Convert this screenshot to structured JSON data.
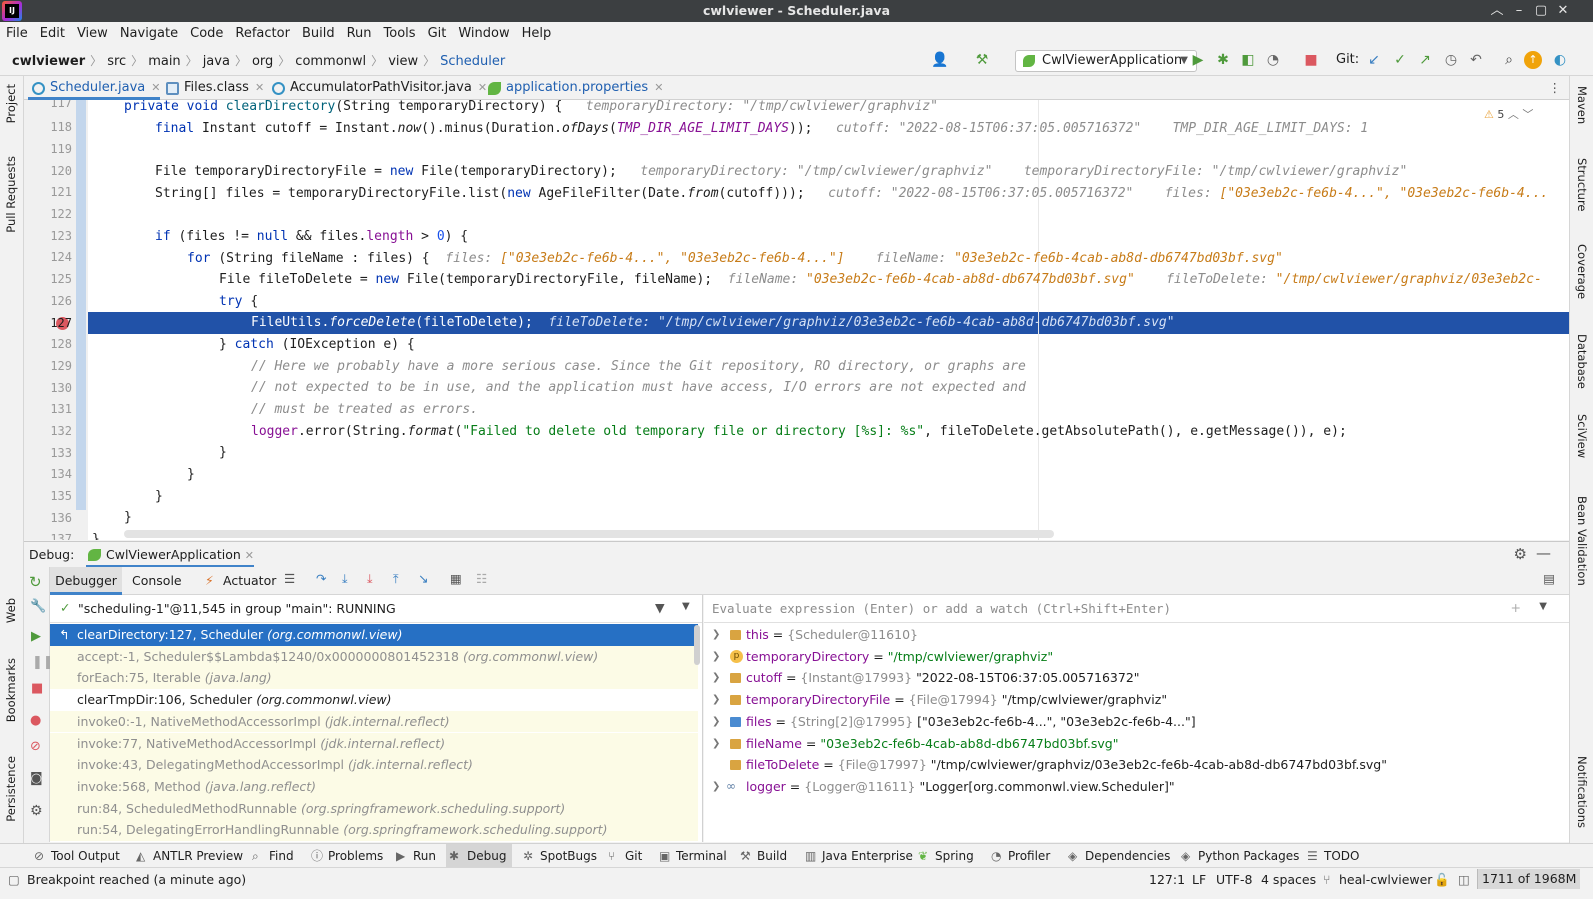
{
  "window": {
    "title": "cwlviewer - Scheduler.java",
    "logo_text": "IJ",
    "controls": [
      "︿",
      "–",
      "▢",
      "✕"
    ]
  },
  "menu": [
    "File",
    "Edit",
    "View",
    "Navigate",
    "Code",
    "Refactor",
    "Build",
    "Run",
    "Tools",
    "Git",
    "Window",
    "Help"
  ],
  "breadcrumb": [
    "cwlviewer",
    "src",
    "main",
    "java",
    "org",
    "commonwl",
    "view",
    "Scheduler"
  ],
  "toolbar": {
    "run_config": "CwlViewerApplication",
    "git_label": "Git:"
  },
  "tabs": [
    {
      "label": "Scheduler.java",
      "active": true
    },
    {
      "label": "Files.class",
      "active": false
    },
    {
      "label": "AccumulatorPathVisitor.java",
      "active": false
    },
    {
      "label": "application.properties",
      "active": false
    }
  ],
  "left_tools": [
    "Project",
    "Pull Requests",
    "Web",
    "Bookmarks",
    "Persistence"
  ],
  "right_tools": [
    "Maven",
    "Structure",
    "Coverage",
    "Database",
    "SciView",
    "Bean Validation",
    "Notifications"
  ],
  "editor": {
    "problems_count": "5",
    "line_numbers": [
      "117",
      "118",
      "119",
      "120",
      "121",
      "122",
      "123",
      "124",
      "125",
      "126",
      "127",
      "128",
      "129",
      "130",
      "131",
      "132",
      "133",
      "134",
      "135",
      "136",
      "137"
    ],
    "current_line": "127",
    "lines": {
      "l117_kw": "private void ",
      "l117_fn": "clearDirectory",
      "l117_rest": "(String temporaryDirectory) {",
      "l117_hint": "temporaryDirectory: ",
      "l117_hv": "\"/tmp/cwlviewer/graphviz\"",
      "l118_kw": "final ",
      "l118_a": "Instant cutoff = Instant.",
      "l118_now": "now",
      "l118_b": "().minus(Duration.",
      "l118_ofdays": "ofDays",
      "l118_c": "(",
      "l118_const": "TMP_DIR_AGE_LIMIT_DAYS",
      "l118_d": "));",
      "l118_hint1": "cutoff: ",
      "l118_hv1": "\"2022-08-15T06:37:05.005716372\"",
      "l118_hint2": "TMP_DIR_AGE_LIMIT_DAYS: ",
      "l118_hv2": "1",
      "l120_a": "File temporaryDirectoryFile = ",
      "l120_kw": "new ",
      "l120_b": "File(temporaryDirectory);",
      "l120_hint1": "temporaryDirectory: ",
      "l120_hv1": "\"/tmp/cwlviewer/graphviz\"",
      "l120_hint2": "temporaryDirectoryFile: ",
      "l120_hv2": "\"/tmp/cwlviewer/graphviz\"",
      "l121_a": "String[] files = temporaryDirectoryFile.list(",
      "l121_kw": "new ",
      "l121_b": "AgeFileFilter(Date.",
      "l121_from": "from",
      "l121_c": "(cutoff)));",
      "l121_hint1": "cutoff: ",
      "l121_hv1": "\"2022-08-15T06:37:05.005716372\"",
      "l121_hint2": "files: ",
      "l121_hv2": "[\"03e3eb2c-fe6b-4...\", \"03e3eb2c-fe6b-4...",
      "l123_kw": "if ",
      "l123_a": "(files != ",
      "l123_null": "null",
      "l123_b": " && files.",
      "l123_len": "length",
      "l123_c": " > ",
      "l123_num": "0",
      "l123_d": ") {",
      "l124_kw": "for ",
      "l124_a": "(String fileName : files) {",
      "l124_hint1": "files: ",
      "l124_hv1": "[\"03e3eb2c-fe6b-4...\", \"03e3eb2c-fe6b-4...\"]",
      "l124_hint2": "fileName: ",
      "l124_hv2": "\"03e3eb2c-fe6b-4cab-ab8d-db6747bd03bf.svg\"",
      "l125_a": "File fileToDelete = ",
      "l125_kw": "new ",
      "l125_b": "File(temporaryDirectoryFile, fileName);",
      "l125_hint1": "fileName: ",
      "l125_hv1": "\"03e3eb2c-fe6b-4cab-ab8d-db6747bd03bf.svg\"",
      "l125_hint2": "fileToDelete: ",
      "l125_hv2": "\"/tmp/cwlviewer/graphviz/03e3eb2c-",
      "l126_kw": "try ",
      "l126_a": "{",
      "l127_a": "FileUtils.",
      "l127_fn": "forceDelete",
      "l127_b": "(fileToDelete);",
      "l127_hint": "fileToDelete: ",
      "l127_hv": "\"/tmp/cwlviewer/graphviz/03e3eb2c-fe6b-4cab-ab8d-db6747bd03bf.svg\"",
      "l128_a": "} ",
      "l128_kw": "catch ",
      "l128_b": "(IOException e) {",
      "l129": "// Here we probably have a more serious case. Since the Git repository, RO directory, or graphs are",
      "l130": "// not expected to be in use, and the application must have access, I/O errors are not expected and",
      "l131": "// must be treated as errors.",
      "l132_logger": "logger",
      "l132_a": ".error(String.",
      "l132_format": "format",
      "l132_b": "(",
      "l132_str": "\"Failed to delete old temporary file or directory [%s]: %s\"",
      "l132_c": ", fileToDelete.getAbsolutePath(), e.getMessage()), e);",
      "l133": "}",
      "l134": "}",
      "l135": "}",
      "l136": "}",
      "l137": "}"
    }
  },
  "debug": {
    "label": "Debug:",
    "session_tab": "CwlViewerApplication",
    "tabs": [
      "Debugger",
      "Console",
      "Actuator"
    ],
    "thread": "\"scheduling-1\"@11,545 in group \"main\": RUNNING",
    "eval_placeholder": "Evaluate expression (Enter) or add a watch (Ctrl+Shift+Enter)",
    "frames": [
      {
        "method": "clearDirectory:127, Scheduler",
        "pkg": "(org.commonwl.view)",
        "type": "selected"
      },
      {
        "method": "accept:-1, Scheduler$$Lambda$1240/0x0000000801452318",
        "pkg": "(org.commonwl.view)",
        "type": "lib"
      },
      {
        "method": "forEach:75, Iterable",
        "pkg": "(java.lang)",
        "type": "lib"
      },
      {
        "method": "clearTmpDir:106, Scheduler",
        "pkg": "(org.commonwl.view)",
        "type": "normal"
      },
      {
        "method": "invoke0:-1, NativeMethodAccessorImpl",
        "pkg": "(jdk.internal.reflect)",
        "type": "lib"
      },
      {
        "method": "invoke:77, NativeMethodAccessorImpl",
        "pkg": "(jdk.internal.reflect)",
        "type": "lib"
      },
      {
        "method": "invoke:43, DelegatingMethodAccessorImpl",
        "pkg": "(jdk.internal.reflect)",
        "type": "lib"
      },
      {
        "method": "invoke:568, Method",
        "pkg": "(java.lang.reflect)",
        "type": "lib"
      },
      {
        "method": "run:84, ScheduledMethodRunnable",
        "pkg": "(org.springframework.scheduling.support)",
        "type": "lib"
      },
      {
        "method": "run:54, DelegatingErrorHandlingRunnable",
        "pkg": "(org.springframework.scheduling.support)",
        "type": "lib"
      }
    ],
    "variables": [
      {
        "name": "this",
        "type": "{Scheduler@11610}",
        "value": "",
        "str": false,
        "expand": true,
        "icon": "field"
      },
      {
        "name": "temporaryDirectory",
        "type": "",
        "value": "\"/tmp/cwlviewer/graphviz\"",
        "str": true,
        "expand": true,
        "icon": "param"
      },
      {
        "name": "cutoff",
        "type": "{Instant@17993}",
        "value": "\"2022-08-15T06:37:05.005716372\"",
        "str": false,
        "expand": true,
        "icon": "field"
      },
      {
        "name": "temporaryDirectoryFile",
        "type": "{File@17994}",
        "value": "\"/tmp/cwlviewer/graphviz\"",
        "str": false,
        "expand": true,
        "icon": "field"
      },
      {
        "name": "files",
        "type": "{String[2]@17995}",
        "value": "[\"03e3eb2c-fe6b-4...\", \"03e3eb2c-fe6b-4...\"]",
        "str": false,
        "expand": true,
        "icon": "array"
      },
      {
        "name": "fileName",
        "type": "",
        "value": "\"03e3eb2c-fe6b-4cab-ab8d-db6747bd03bf.svg\"",
        "str": true,
        "expand": true,
        "icon": "field"
      },
      {
        "name": "fileToDelete",
        "type": "{File@17997}",
        "value": "\"/tmp/cwlviewer/graphviz/03e3eb2c-fe6b-4cab-ab8d-db6747bd03bf.svg\"",
        "str": false,
        "expand": false,
        "icon": "field"
      },
      {
        "name": "logger",
        "type": "{Logger@11611}",
        "value": "\"Logger[org.commonwl.view.Scheduler]\"",
        "str": false,
        "expand": true,
        "icon": "ref"
      }
    ]
  },
  "bottom_tools": [
    "Tool Output",
    "ANTLR Preview",
    "Find",
    "Problems",
    "Run",
    "Debug",
    "SpotBugs",
    "Git",
    "Terminal",
    "Build",
    "Java Enterprise",
    "Spring",
    "Profiler",
    "Dependencies",
    "Python Packages",
    "TODO"
  ],
  "status": {
    "message": "Breakpoint reached (a minute ago)",
    "position": "127:1",
    "line_sep": "LF",
    "encoding": "UTF-8",
    "indent": "4 spaces",
    "branch": "heal-cwlviewer",
    "memory": "1711 of 1968M"
  }
}
